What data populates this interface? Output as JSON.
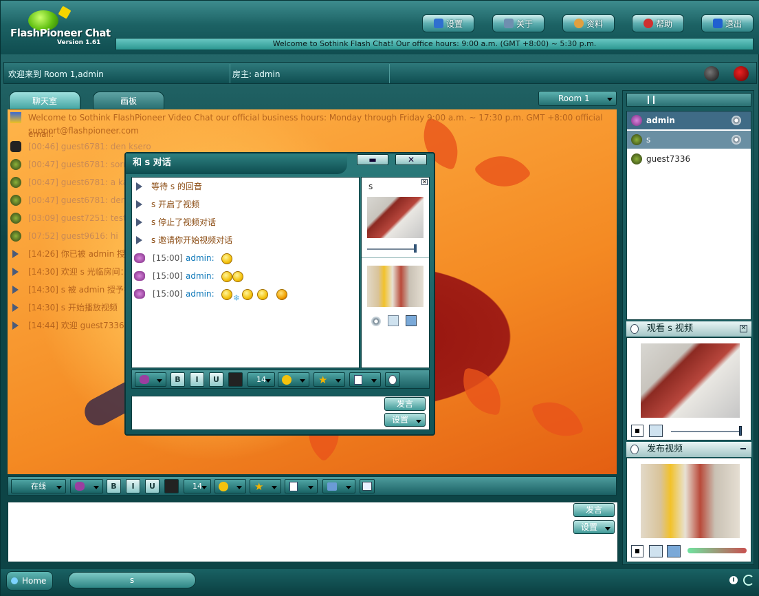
{
  "app": {
    "logo_title": "FlashPioneer Chat",
    "logo_version": "Version 1.61",
    "marquee": "Welcome to Sothink Flash Chat! Our office hours: 9:00 a.m. (GMT +8:00) ~ 5:30 p.m."
  },
  "topnav": [
    {
      "label": "设置",
      "icon": "gear-icon",
      "color": "#2f6fd0"
    },
    {
      "label": "关于",
      "icon": "about-icon",
      "color": "#6f8fb0"
    },
    {
      "label": "资料",
      "icon": "profile-icon",
      "color": "#e0a040"
    },
    {
      "label": "帮助",
      "icon": "help-icon",
      "color": "#d03030"
    },
    {
      "label": "退出",
      "icon": "exit-icon",
      "color": "#2060d0"
    }
  ],
  "infobar": {
    "welcome": "欢迎来到 Room 1,admin",
    "owner": "房主: admin"
  },
  "tabs": [
    {
      "label": "聊天室"
    },
    {
      "label": "画板"
    }
  ],
  "room_select": "Room 1",
  "messages": [
    {
      "text": "Welcome to Sothink FlashPioneer Video Chat  our official business hours: Monday through Friday 9:00 a.m. ~ 17:30 p.m. GMT +8:00 official email:",
      "text2": "support@flashpioneer.com"
    },
    {
      "text": "[00:46] guest6781: den ksero"
    },
    {
      "text": "[00:47] guest6781: sorry e"
    },
    {
      "text": "[00:47] guest6781: a kai t"
    },
    {
      "text": "[00:47] guest6781: den pe"
    },
    {
      "text": "[03:09] guest7251: test"
    },
    {
      "text": "[07:52] guest9616: hi"
    },
    {
      "text": "[14:26] 你已被 admin 授予"
    },
    {
      "text": "[14:30] 欢迎 s 光临房间：R"
    },
    {
      "text": "[14:30] s 被 admin 授予视"
    },
    {
      "text": "[14:30] s 开始播放视频"
    },
    {
      "text": "[14:44] 欢迎 guest7336 光"
    }
  ],
  "toolbar": {
    "status": "在线",
    "bold": "B",
    "italic": "I",
    "underline": "U",
    "font_size": "14"
  },
  "input": {
    "send": "发言",
    "settings": "设置"
  },
  "bottom": {
    "home": "Home",
    "user": "s"
  },
  "users": [
    {
      "name": "admin"
    },
    {
      "name": "s"
    },
    {
      "name": "guest7336"
    }
  ],
  "watch_panel": {
    "title": "观看 s 视频"
  },
  "publish_panel": {
    "title": "发布视频"
  },
  "dialog": {
    "title": "和 s 对话",
    "video_label": "s",
    "system": [
      "等待 s 的回音",
      "s 开启了视频",
      "s 停止了视频对话",
      "s 邀请你开始视频对话"
    ],
    "chats": [
      {
        "time": "[15:00]",
        "name": "admin:"
      },
      {
        "time": "[15:00]",
        "name": "admin:"
      },
      {
        "time": "[15:00]",
        "name": "admin:"
      }
    ],
    "font_size": "14",
    "send": "发言",
    "settings": "设置"
  }
}
